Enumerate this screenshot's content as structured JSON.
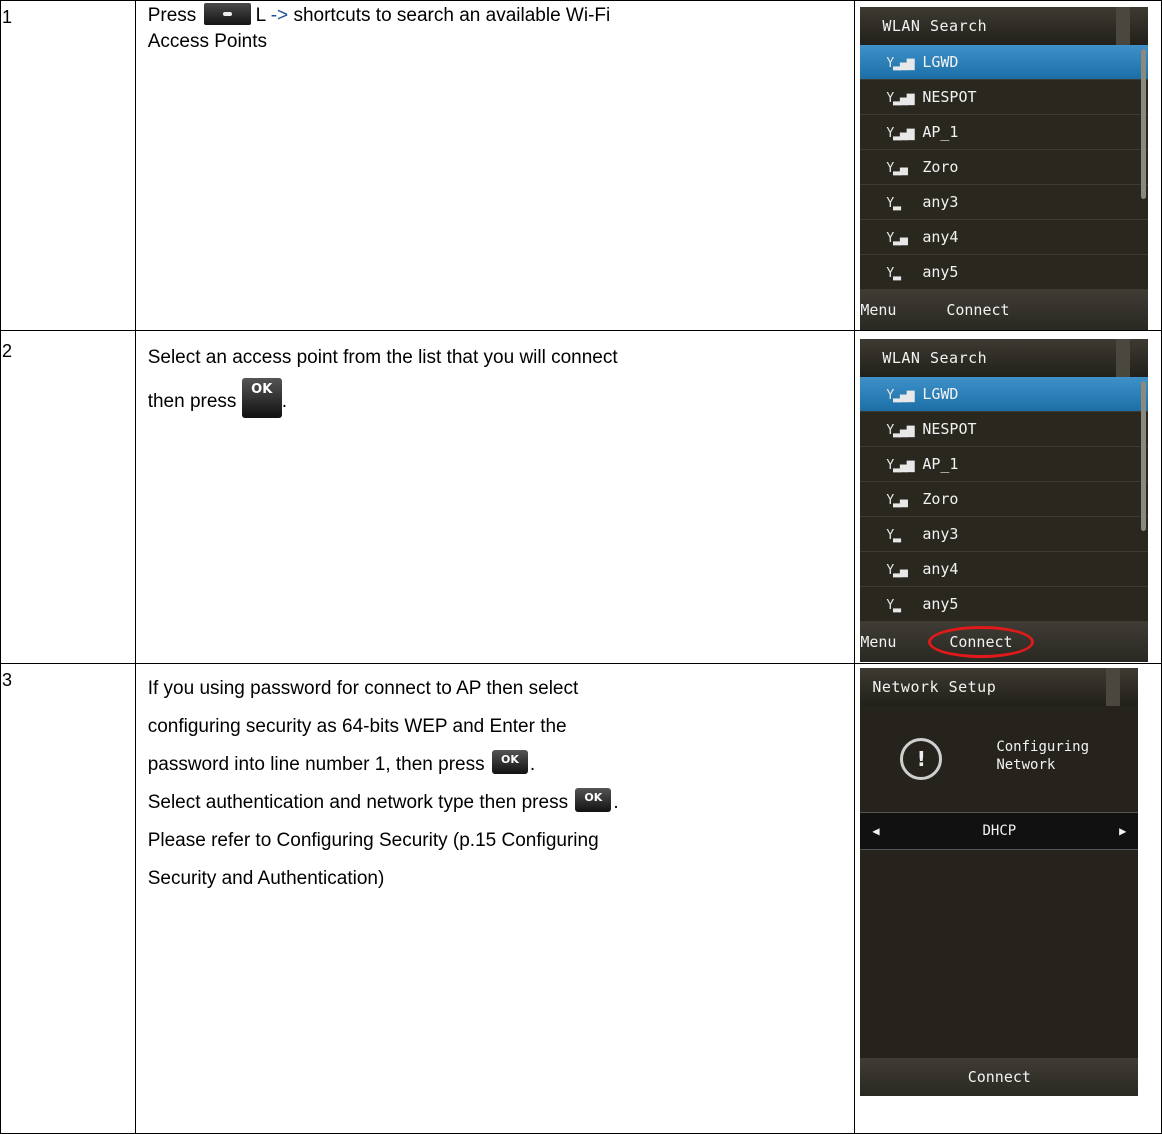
{
  "steps": [
    {
      "number": "1",
      "text_press": "Press",
      "text_key_letter": "L",
      "text_arrow": "->",
      "text_after_arrow": "shortcuts to search an available Wi-Fi",
      "text_line2": "Access Points",
      "screen": {
        "title": "WLAN Search",
        "items": [
          "LGWD",
          "NESPOT",
          "AP_1",
          "Zoro",
          "any3",
          "any4",
          "any5"
        ],
        "selected_index": 0,
        "soft_left": "Menu",
        "soft_right": "Connect"
      }
    },
    {
      "number": "2",
      "text_line1": "Select an access point from the list that you will connect",
      "text_then_press": "then press",
      "text_end": ".",
      "screen": {
        "title": "WLAN Search",
        "items": [
          "LGWD",
          "NESPOT",
          "AP_1",
          "Zoro",
          "any3",
          "any4",
          "any5"
        ],
        "selected_index": 0,
        "soft_left": "Menu",
        "soft_right": "Connect"
      }
    },
    {
      "number": "3",
      "text_line1": "If you using password for connect to AP then select",
      "text_line2": "configuring security as 64-bits WEP and Enter the",
      "text_line3": "password into line number 1, then press",
      "text_line3_end": ".",
      "text_line4": "Select authentication and network type then press",
      "text_line4_end": ".",
      "text_line5": "Please refer to Configuring Security (p.15 Configuring",
      "text_line6": "Security and Authentication)",
      "screen": {
        "title": "Network Setup",
        "message_line1": "Configuring",
        "message_line2": "Network",
        "picker_value": "DHCP",
        "bottom_label": "Connect"
      }
    }
  ],
  "ok_key_label": "OK",
  "colors": {
    "selection": "#2a80bb",
    "circle": "#e01a1a",
    "arrow": "#1e4e9a"
  }
}
